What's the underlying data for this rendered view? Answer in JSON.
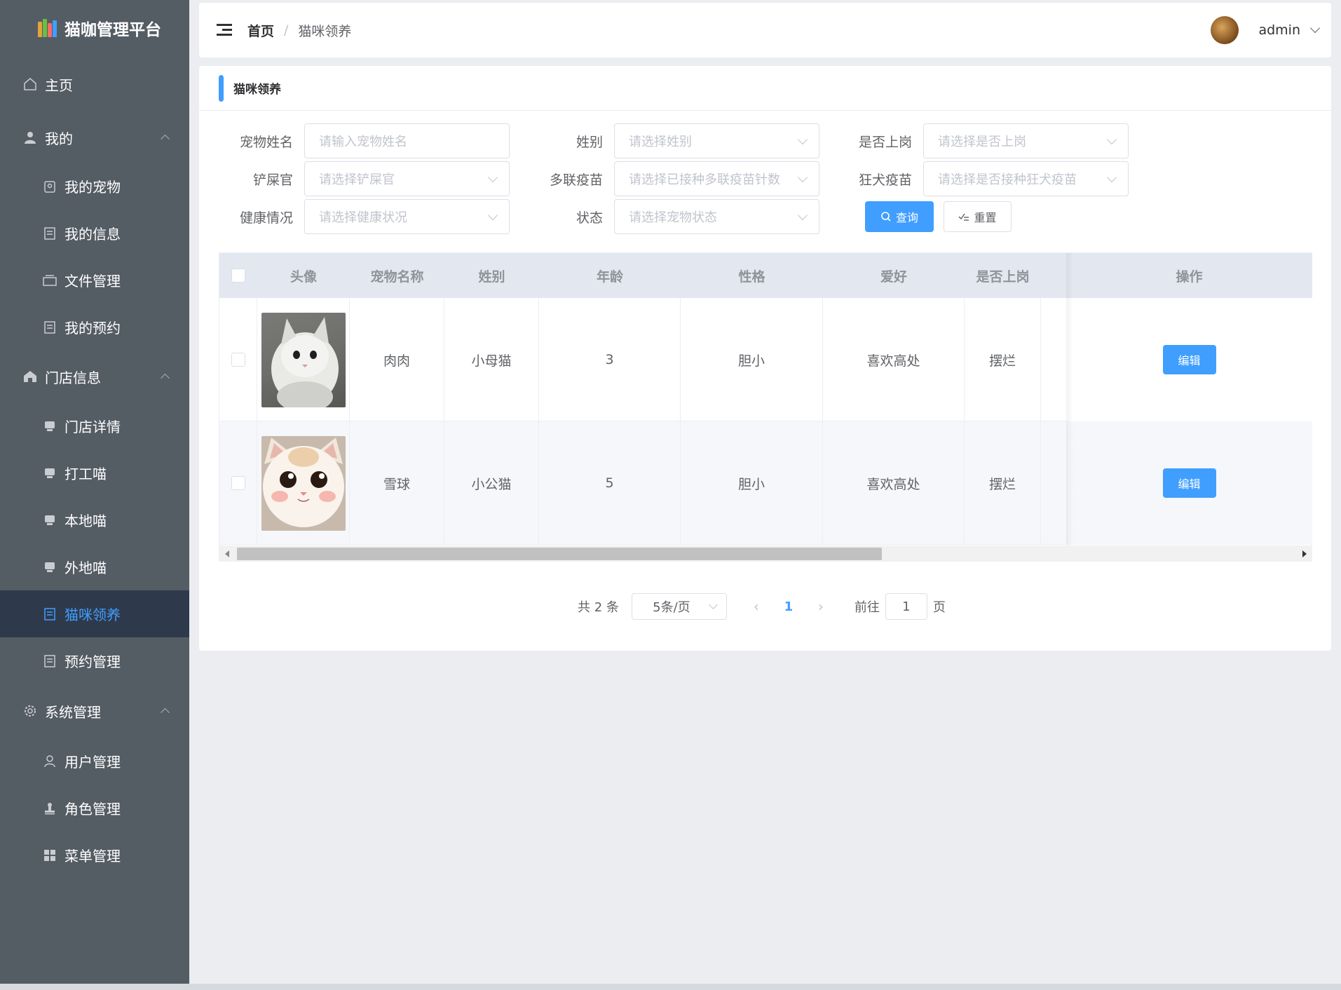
{
  "app": {
    "title": "猫咖管理平台"
  },
  "sidebar": {
    "items": [
      {
        "label": "主页",
        "icon": "home-icon",
        "level": "top"
      },
      {
        "label": "我的",
        "icon": "user-icon",
        "level": "top",
        "expandable": true
      },
      {
        "label": "我的宠物",
        "icon": "pet-icon",
        "level": "sub"
      },
      {
        "label": "我的信息",
        "icon": "document-icon",
        "level": "sub"
      },
      {
        "label": "文件管理",
        "icon": "folder-icon",
        "level": "sub"
      },
      {
        "label": "我的预约",
        "icon": "document-icon",
        "level": "sub"
      },
      {
        "label": "门店信息",
        "icon": "shop-icon",
        "level": "top",
        "expandable": true
      },
      {
        "label": "门店详情",
        "icon": "tray-icon",
        "level": "sub"
      },
      {
        "label": "打工喵",
        "icon": "tray-icon",
        "level": "sub"
      },
      {
        "label": "本地喵",
        "icon": "tray-icon",
        "level": "sub"
      },
      {
        "label": "外地喵",
        "icon": "tray-icon",
        "level": "sub"
      },
      {
        "label": "猫咪领养",
        "icon": "document-icon",
        "level": "sub",
        "active": true
      },
      {
        "label": "预约管理",
        "icon": "document-icon",
        "level": "sub"
      },
      {
        "label": "系统管理",
        "icon": "gear-icon",
        "level": "top",
        "expandable": true
      },
      {
        "label": "用户管理",
        "icon": "user-outline-icon",
        "level": "sub"
      },
      {
        "label": "角色管理",
        "icon": "stamp-icon",
        "level": "sub"
      },
      {
        "label": "菜单管理",
        "icon": "grid-icon",
        "level": "sub"
      }
    ]
  },
  "header": {
    "breadcrumb_home": "首页",
    "breadcrumb_sep": "/",
    "breadcrumb_current": "猫咪领养",
    "username": "admin"
  },
  "page": {
    "title": "猫咪领养"
  },
  "filters": {
    "pet_name": {
      "label": "宠物姓名",
      "placeholder": "请输入宠物姓名"
    },
    "gender": {
      "label": "姓别",
      "placeholder": "请选择姓别"
    },
    "on_duty": {
      "label": "是否上岗",
      "placeholder": "请选择是否上岗"
    },
    "owner": {
      "label": "铲屎官",
      "placeholder": "请选择铲屎官"
    },
    "multi_vaccine": {
      "label": "多联疫苗",
      "placeholder": "请选择已接种多联疫苗针数"
    },
    "rabies": {
      "label": "狂犬疫苗",
      "placeholder": "请选择是否接种狂犬疫苗"
    },
    "health": {
      "label": "健康情况",
      "placeholder": "请选择健康状况"
    },
    "status": {
      "label": "状态",
      "placeholder": "请选择宠物状态"
    },
    "query_label": "查询",
    "reset_label": "重置"
  },
  "table": {
    "headers": [
      "头像",
      "宠物名称",
      "姓别",
      "年龄",
      "性格",
      "爱好",
      "是否上岗",
      "操作"
    ],
    "rows": [
      {
        "name": "肉肉",
        "gender": "小母猫",
        "age": "3",
        "personality": "胆小",
        "hobby": "喜欢高处",
        "on_duty": "摆烂",
        "action": "编辑"
      },
      {
        "name": "雪球",
        "gender": "小公猫",
        "age": "5",
        "personality": "胆小",
        "hobby": "喜欢高处",
        "on_duty": "摆烂",
        "action": "编辑"
      }
    ]
  },
  "pagination": {
    "total": "共 2 条",
    "page_size": "5条/页",
    "current_page": "1",
    "goto_label": "前往",
    "goto_value": "1",
    "page_suffix": "页"
  },
  "colors": {
    "accent": "#409eff",
    "sidebar_bg": "#545c64",
    "sidebar_active_bg": "#2e3a4b"
  }
}
